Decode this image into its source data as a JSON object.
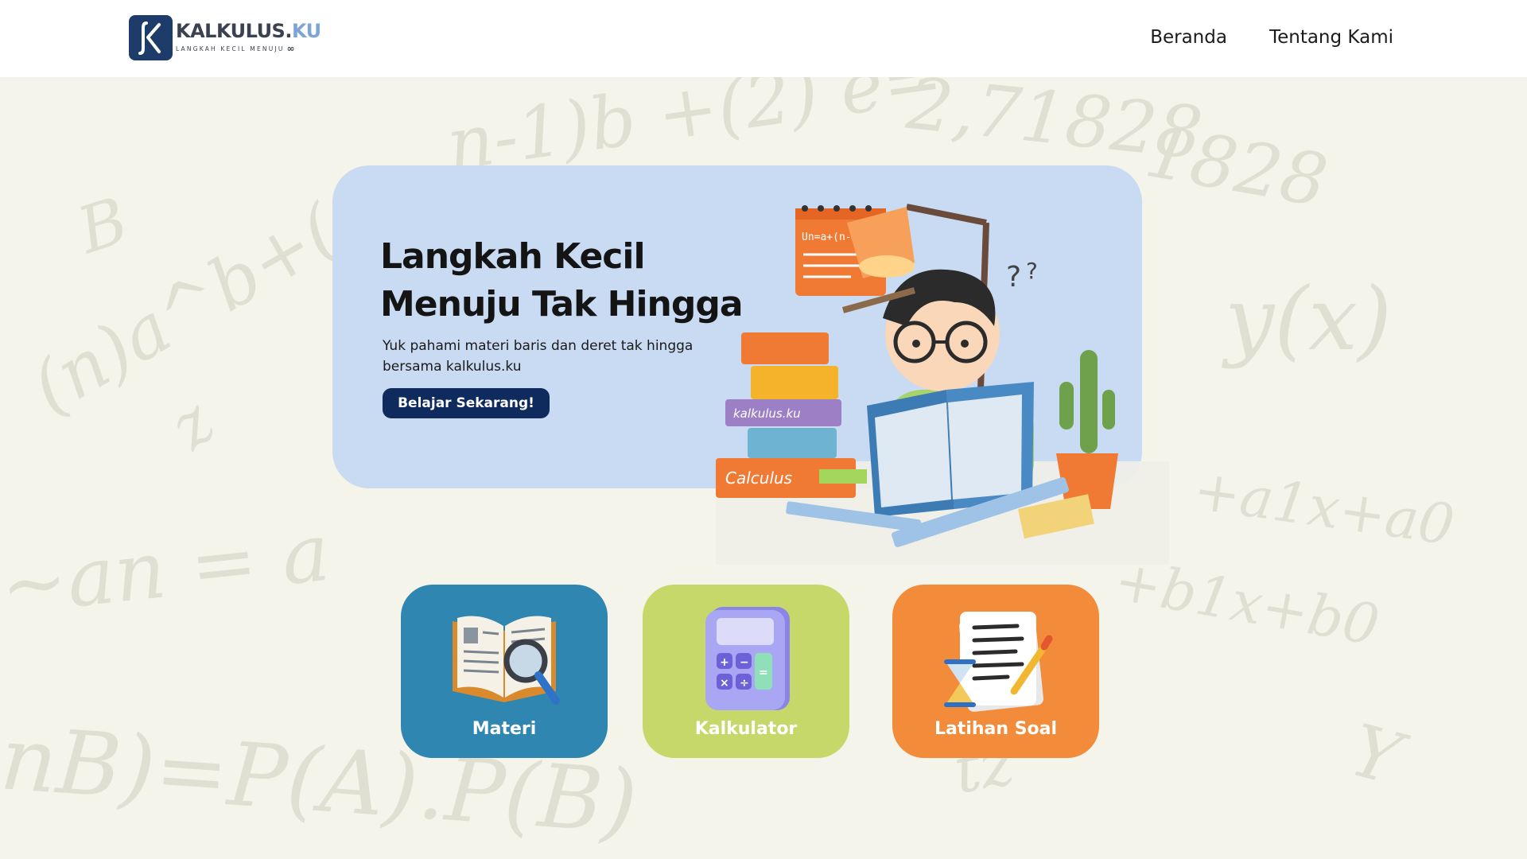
{
  "header": {
    "logo_title": "KALKULUS.",
    "logo_title_accent": "KU",
    "logo_subtitle": "LANGKAH KECIL MENUJU",
    "nav": [
      {
        "label": "Beranda"
      },
      {
        "label": "Tentang Kami"
      }
    ]
  },
  "hero": {
    "title_line1": "Langkah Kecil",
    "title_line2": "Menuju Tak Hingga",
    "description": "Yuk pahami materi baris dan deret tak hingga bersama kalkulus.ku",
    "button_label": "Belajar Sekarang!",
    "notebook_text": "Un=a+(n-1)b",
    "book_label_1": "kalkulus.ku",
    "book_label_2": "Calculus"
  },
  "cards": [
    {
      "label": "Materi",
      "color": "#2e86b1",
      "icon": "open-book-magnifier-icon"
    },
    {
      "label": "Kalkulator",
      "color": "#c6d86a",
      "icon": "calculator-icon"
    },
    {
      "label": "Latihan Soal",
      "color": "#f38c3a",
      "icon": "exam-paper-hourglass-icon"
    }
  ],
  "colors": {
    "hero_bg": "#c9dbf2",
    "button_bg": "#0f2a5c",
    "page_bg": "#f5f4ea"
  }
}
